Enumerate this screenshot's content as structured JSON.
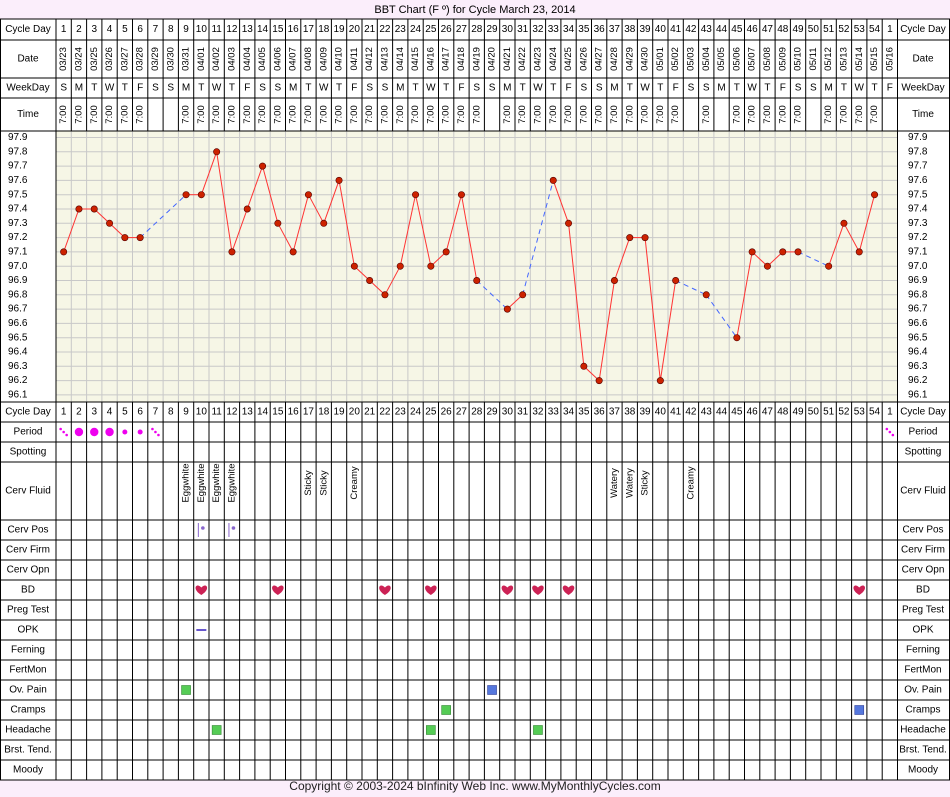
{
  "chart_data": {
    "type": "line",
    "title": "BBT Chart (F º) for Cycle March 23, 2014",
    "footer": "Copyright © 2003-2024 bInfinity Web Inc.     www.MyMonthlyCycles.com",
    "row_labels": {
      "cycle_day": "Cycle Day",
      "date": "Date",
      "weekday": "WeekDay",
      "time": "Time"
    },
    "cycle_days": [
      "1",
      "2",
      "3",
      "4",
      "5",
      "6",
      "7",
      "8",
      "9",
      "10",
      "11",
      "12",
      "13",
      "14",
      "15",
      "16",
      "17",
      "18",
      "19",
      "20",
      "21",
      "22",
      "23",
      "24",
      "25",
      "26",
      "27",
      "28",
      "29",
      "30",
      "31",
      "32",
      "33",
      "34",
      "35",
      "36",
      "37",
      "38",
      "39",
      "40",
      "41",
      "42",
      "43",
      "44",
      "45",
      "46",
      "47",
      "48",
      "49",
      "50",
      "51",
      "52",
      "53",
      "54",
      "1"
    ],
    "dates": [
      "03/23",
      "03/24",
      "03/25",
      "03/26",
      "03/27",
      "03/28",
      "03/29",
      "03/30",
      "03/31",
      "04/01",
      "04/02",
      "04/03",
      "04/04",
      "04/05",
      "04/06",
      "04/07",
      "04/08",
      "04/09",
      "04/10",
      "04/11",
      "04/12",
      "04/13",
      "04/14",
      "04/15",
      "04/16",
      "04/17",
      "04/18",
      "04/19",
      "04/20",
      "04/21",
      "04/22",
      "04/23",
      "04/24",
      "04/25",
      "04/26",
      "04/27",
      "04/28",
      "04/29",
      "04/30",
      "05/01",
      "05/02",
      "05/03",
      "05/04",
      "05/05",
      "05/06",
      "05/07",
      "05/08",
      "05/09",
      "05/10",
      "05/11",
      "05/12",
      "05/13",
      "05/14",
      "05/15",
      "05/16"
    ],
    "weekdays": [
      "S",
      "M",
      "T",
      "W",
      "T",
      "F",
      "S",
      "S",
      "M",
      "T",
      "W",
      "T",
      "F",
      "S",
      "S",
      "M",
      "T",
      "W",
      "T",
      "F",
      "S",
      "S",
      "M",
      "T",
      "W",
      "T",
      "F",
      "S",
      "S",
      "M",
      "T",
      "W",
      "T",
      "F",
      "S",
      "S",
      "M",
      "T",
      "W",
      "T",
      "F",
      "S",
      "S",
      "M",
      "T",
      "W",
      "T",
      "F",
      "S",
      "S",
      "M",
      "T",
      "W",
      "T",
      "F"
    ],
    "times": [
      "7:00",
      "7:00",
      "7:00",
      "7:00",
      "7:00",
      "7:00",
      "",
      "",
      "7:00",
      "7:00",
      "7:00",
      "7:00",
      "7:00",
      "7:00",
      "7:00",
      "7:00",
      "7:00",
      "7:00",
      "7:00",
      "7:00",
      "7:00",
      "7:00",
      "7:00",
      "7:00",
      "7:00",
      "7:00",
      "7:00",
      "7:00",
      "",
      "7:00",
      "7:00",
      "7:00",
      "7:00",
      "7:00",
      "7:00",
      "7:00",
      "7:00",
      "7:00",
      "7:00",
      "7:00",
      "7:00",
      "",
      "7:00",
      "",
      "7:00",
      "7:00",
      "7:00",
      "7:00",
      "7:00",
      "",
      "7:00",
      "7:00",
      "7:00",
      "7:00",
      ""
    ],
    "temps": [
      97.1,
      97.4,
      97.4,
      97.3,
      97.2,
      97.2,
      null,
      null,
      97.5,
      97.5,
      97.8,
      97.1,
      97.4,
      97.7,
      97.3,
      97.1,
      97.5,
      97.3,
      97.6,
      97.0,
      96.9,
      96.8,
      97.0,
      97.5,
      97.0,
      97.1,
      97.5,
      96.9,
      null,
      96.7,
      96.8,
      null,
      97.6,
      97.3,
      96.3,
      96.2,
      96.9,
      97.2,
      97.2,
      96.2,
      96.9,
      null,
      96.8,
      null,
      96.5,
      97.1,
      97.0,
      97.1,
      97.1,
      null,
      97.0,
      97.3,
      97.1,
      97.5,
      null
    ],
    "y_ticks": [
      "97.9",
      "97.8",
      "97.7",
      "97.6",
      "97.5",
      "97.4",
      "97.3",
      "97.2",
      "97.1",
      "97.0",
      "96.9",
      "96.8",
      "96.7",
      "96.6",
      "96.5",
      "96.4",
      "96.3",
      "96.2",
      "96.1"
    ],
    "ylim": [
      96.1,
      97.9
    ],
    "colors": {
      "line": "#ff3333",
      "gap_line": "#4466ff",
      "point": "#cc2200",
      "plot_bg": "#f6f6e6",
      "grid": "#c8c8c8",
      "page_bg": "#fbeefb",
      "period_dot": "#ee00ee",
      "heart": "#cc2255",
      "green": "#55cc55",
      "blue": "#5577dd",
      "opk": "#6655cc",
      "cerv_pos": "#8866cc"
    },
    "rows": [
      {
        "label": "Period",
        "kind": "period",
        "marks": [
          {
            "day": 1,
            "v": "spot"
          },
          {
            "day": 2,
            "v": "heavy"
          },
          {
            "day": 3,
            "v": "heavy"
          },
          {
            "day": 4,
            "v": "heavy"
          },
          {
            "day": 5,
            "v": "light"
          },
          {
            "day": 6,
            "v": "light"
          },
          {
            "day": 7,
            "v": "spot"
          },
          {
            "day": 55,
            "v": "spot"
          }
        ]
      },
      {
        "label": "Spotting",
        "kind": "empty",
        "marks": []
      },
      {
        "label": "Cerv Fluid",
        "kind": "text",
        "marks": [
          {
            "day": 9,
            "v": "Eggwhite"
          },
          {
            "day": 10,
            "v": "Eggwhite"
          },
          {
            "day": 11,
            "v": "Eggwhite"
          },
          {
            "day": 12,
            "v": "Eggwhite"
          },
          {
            "day": 17,
            "v": "Sticky"
          },
          {
            "day": 18,
            "v": "Sticky"
          },
          {
            "day": 20,
            "v": "Creamy"
          },
          {
            "day": 37,
            "v": "Watery"
          },
          {
            "day": 38,
            "v": "Watery"
          },
          {
            "day": 39,
            "v": "Sticky"
          },
          {
            "day": 42,
            "v": "Creamy"
          }
        ]
      },
      {
        "label": "Cerv Pos",
        "kind": "cervpos",
        "marks": [
          {
            "day": 10,
            "v": "high"
          },
          {
            "day": 12,
            "v": "high"
          }
        ]
      },
      {
        "label": "Cerv Firm",
        "kind": "empty",
        "marks": []
      },
      {
        "label": "Cerv Opn",
        "kind": "empty",
        "marks": []
      },
      {
        "label": "BD",
        "kind": "heart",
        "marks": [
          {
            "day": 10,
            "v": "heart"
          },
          {
            "day": 15,
            "v": "heart"
          },
          {
            "day": 22,
            "v": "heart"
          },
          {
            "day": 25,
            "v": "heart"
          },
          {
            "day": 30,
            "v": "heart"
          },
          {
            "day": 32,
            "v": "heart"
          },
          {
            "day": 34,
            "v": "heart"
          },
          {
            "day": 53,
            "v": "heart"
          }
        ]
      },
      {
        "label": "Preg Test",
        "kind": "empty",
        "marks": []
      },
      {
        "label": "OPK",
        "kind": "opk",
        "marks": [
          {
            "day": 10,
            "v": "dash"
          }
        ]
      },
      {
        "label": "Ferning",
        "kind": "empty",
        "marks": []
      },
      {
        "label": "FertMon",
        "kind": "empty",
        "marks": []
      },
      {
        "label": "Ov. Pain",
        "kind": "square",
        "marks": [
          {
            "day": 9,
            "v": "green"
          },
          {
            "day": 29,
            "v": "blue"
          }
        ]
      },
      {
        "label": "Cramps",
        "kind": "square",
        "marks": [
          {
            "day": 26,
            "v": "green"
          },
          {
            "day": 53,
            "v": "blue"
          }
        ]
      },
      {
        "label": "Headache",
        "kind": "square",
        "marks": [
          {
            "day": 11,
            "v": "green"
          },
          {
            "day": 25,
            "v": "green"
          },
          {
            "day": 32,
            "v": "green"
          }
        ]
      },
      {
        "label": "Brst. Tend.",
        "kind": "empty",
        "marks": []
      },
      {
        "label": "Moody",
        "kind": "empty",
        "marks": []
      }
    ]
  }
}
